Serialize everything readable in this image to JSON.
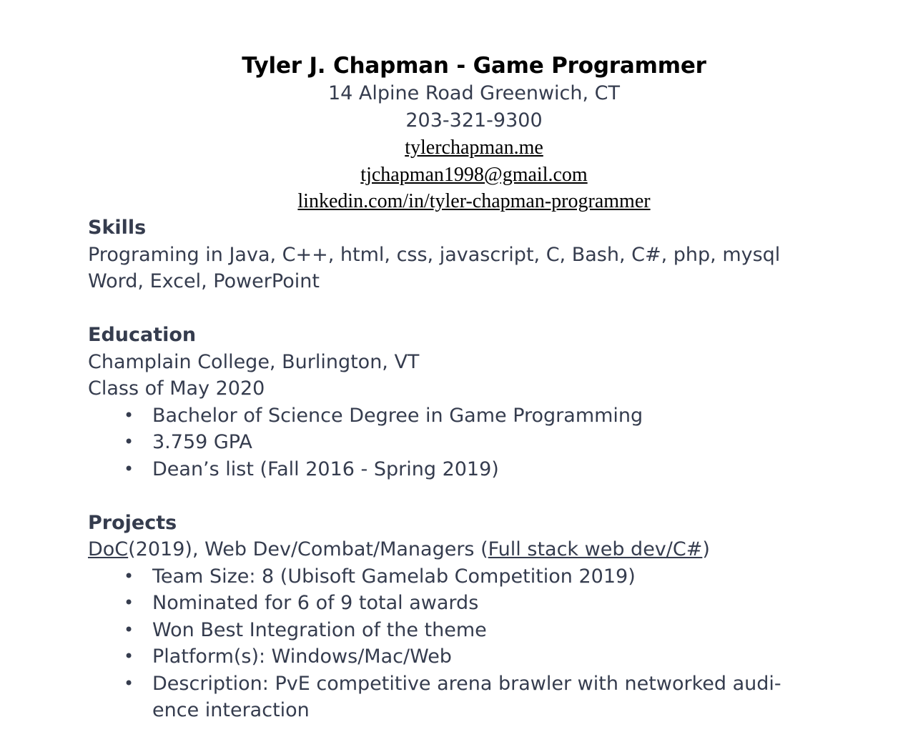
{
  "header": {
    "name": "Tyler J. Chapman - Game Programmer",
    "address": "14 Alpine Road Greenwich, CT",
    "phone": "203-321-9300",
    "website": "tylerchapman.me",
    "email": "tjchapman1998@gmail.com",
    "linkedin": "linkedin.com/in/tyler-chapman-programmer"
  },
  "skills": {
    "title": "Skills",
    "lines": [
      "Programing in Java, C++, html, css, javascript, C, Bash, C#, php, mysql",
      "Word, Excel, PowerPoint"
    ]
  },
  "education": {
    "title": "Education",
    "school": "Champlain College, Burlington, VT",
    "class_of": "Class of May 2020",
    "bullets": [
      "Bachelor of Science Degree in Game Programming",
      "3.759 GPA",
      "Dean’s list (Fall 2016 - Spring 2019)"
    ]
  },
  "projects": {
    "title": "Projects",
    "project_link": "DoC",
    "project_middle": "(2019), Web Dev/Combat/Managers (",
    "project_link2": "Full stack web dev/C#",
    "project_end": ")",
    "bullets": [
      "Team Size: 8 (Ubisoft Gamelab Competition 2019)",
      "Nominated for 6 of 9 total awards",
      "Won Best Integration of the theme",
      "Platform(s): Windows/Mac/Web"
    ],
    "description_line1": "Description: PvE competitive arena brawler with networked audi-",
    "description_line2": "ence interaction",
    "bullet_char": "•"
  }
}
